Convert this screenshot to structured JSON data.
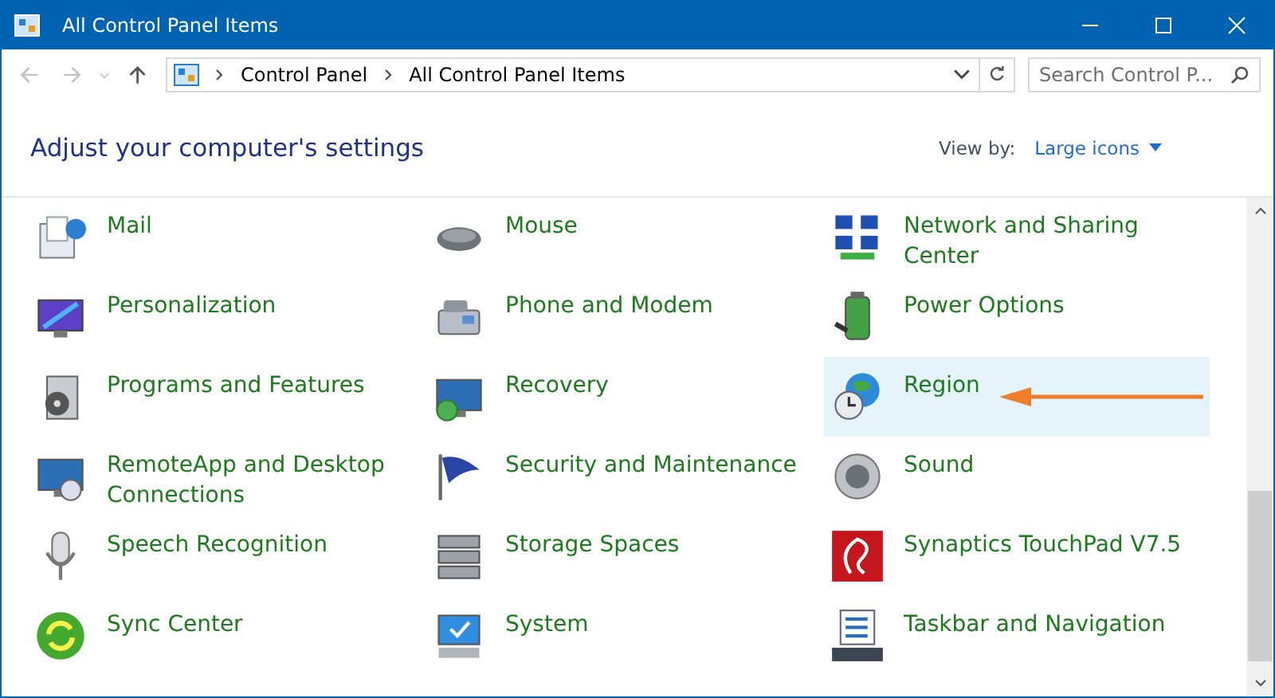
{
  "window": {
    "title": "All Control Panel Items"
  },
  "address": {
    "crumbs": [
      "Control Panel",
      "All Control Panel Items"
    ]
  },
  "search": {
    "placeholder": "Search Control P..."
  },
  "heading": "Adjust your computer's settings",
  "view_by": {
    "label": "View by:",
    "value": "Large icons"
  },
  "items": [
    {
      "label": "Mail",
      "selected": false
    },
    {
      "label": "Mouse",
      "selected": false
    },
    {
      "label": "Network and Sharing Center",
      "selected": false
    },
    {
      "label": "Personalization",
      "selected": false
    },
    {
      "label": "Phone and Modem",
      "selected": false
    },
    {
      "label": "Power Options",
      "selected": false
    },
    {
      "label": "Programs and Features",
      "selected": false
    },
    {
      "label": "Recovery",
      "selected": false
    },
    {
      "label": "Region",
      "selected": true
    },
    {
      "label": "RemoteApp and Desktop Connections",
      "selected": false
    },
    {
      "label": "Security and Maintenance",
      "selected": false
    },
    {
      "label": "Sound",
      "selected": false
    },
    {
      "label": "Speech Recognition",
      "selected": false
    },
    {
      "label": "Storage Spaces",
      "selected": false
    },
    {
      "label": "Synaptics TouchPad V7.5",
      "selected": false
    },
    {
      "label": "Sync Center",
      "selected": false
    },
    {
      "label": "System",
      "selected": false
    },
    {
      "label": "Taskbar and Navigation",
      "selected": false
    }
  ]
}
